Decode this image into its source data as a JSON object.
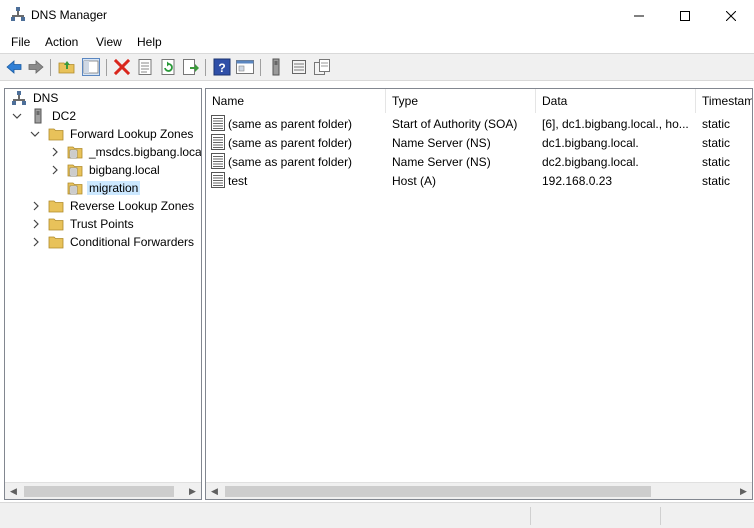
{
  "window": {
    "title": "DNS Manager",
    "minimize": "—",
    "maximize": "☐",
    "close": "✕"
  },
  "menu": [
    "File",
    "Action",
    "View",
    "Help"
  ],
  "tree": {
    "root": "DNS",
    "server": "DC2",
    "forward_zones": "Forward Lookup Zones",
    "msdcs": "_msdcs.bigbang.local",
    "bigbang": "bigbang.local",
    "migration": "migration",
    "reverse_zones": "Reverse Lookup Zones",
    "trust_points": "Trust Points",
    "conditional_forwarders": "Conditional Forwarders"
  },
  "list": {
    "columns": [
      "Name",
      "Type",
      "Data",
      "Timestamp"
    ],
    "rows": [
      {
        "name": "(same as parent folder)",
        "type": "Start of Authority (SOA)",
        "data": "[6], dc1.bigbang.local., ho...",
        "timestamp": "static"
      },
      {
        "name": "(same as parent folder)",
        "type": "Name Server (NS)",
        "data": "dc1.bigbang.local.",
        "timestamp": "static"
      },
      {
        "name": "(same as parent folder)",
        "type": "Name Server (NS)",
        "data": "dc2.bigbang.local.",
        "timestamp": "static"
      },
      {
        "name": "test",
        "type": "Host (A)",
        "data": "192.168.0.23",
        "timestamp": "static"
      }
    ]
  },
  "colors": {
    "selection": "#cce8ff",
    "folder": "#e8c25a",
    "delete": "#d9261c",
    "help": "#2f4fa8"
  }
}
